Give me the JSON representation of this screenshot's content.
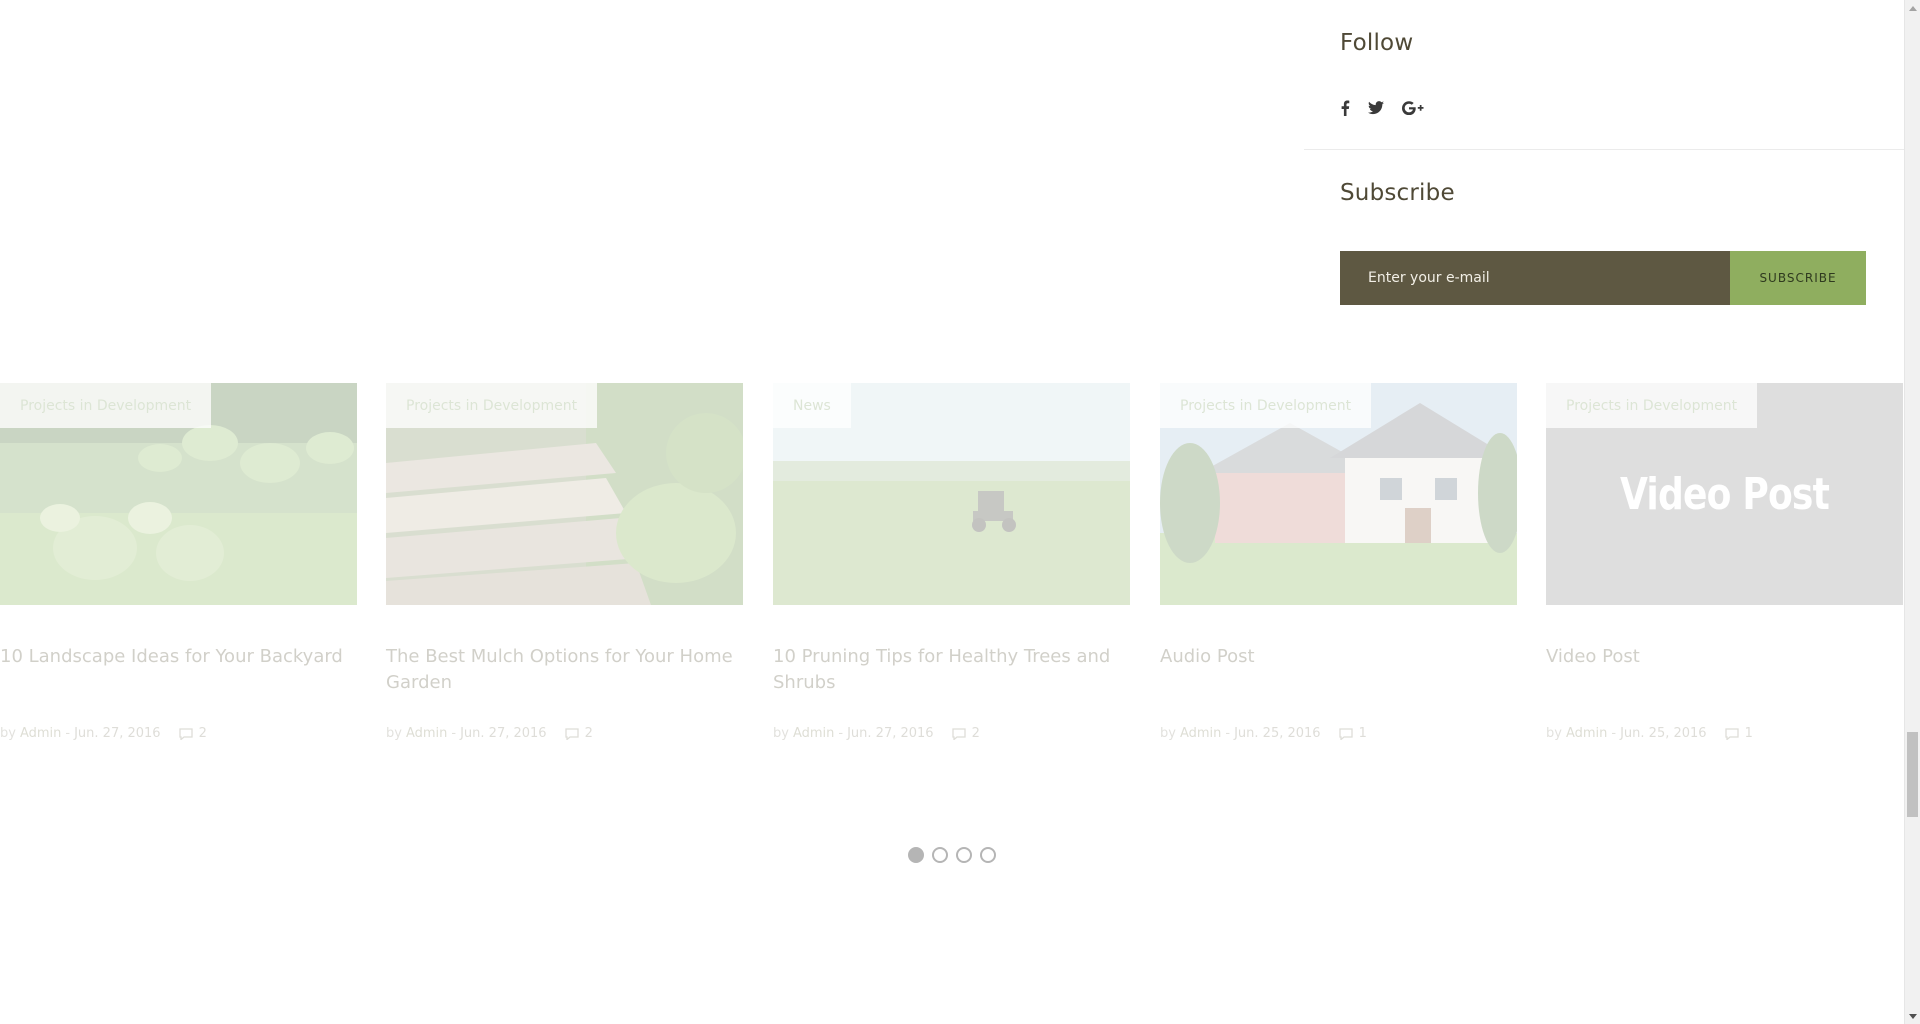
{
  "follow": {
    "title": "Follow",
    "social": [
      {
        "icon": "facebook-icon"
      },
      {
        "icon": "twitter-icon"
      },
      {
        "icon": "google-plus-icon"
      }
    ]
  },
  "subscribe": {
    "title": "Subscribe",
    "placeholder": "Enter your e-mail",
    "button_label": "SUBSCRIBE"
  },
  "posts": [
    {
      "category": "Projects in Development",
      "title": "10 Landscape Ideas for Your Backyard",
      "by": "by",
      "author": "Admin",
      "sep": "-",
      "date": "Jun. 27, 2016",
      "comments": "2"
    },
    {
      "category": "Projects in Development",
      "title": "The Best Mulch Options for Your Home Garden",
      "by": "by",
      "author": "Admin",
      "sep": "-",
      "date": "Jun. 27, 2016",
      "comments": "2"
    },
    {
      "category": "News",
      "title": "10 Pruning Tips for Healthy Trees and Shrubs",
      "by": "by",
      "author": "Admin",
      "sep": "-",
      "date": "Jun. 27, 2016",
      "comments": "2"
    },
    {
      "category": "Projects in Development",
      "title": "Audio Post",
      "by": "by",
      "author": "Admin",
      "sep": "-",
      "date": "Jun. 25, 2016",
      "comments": "1"
    },
    {
      "category": "Projects in Development",
      "title": "Video Post",
      "by": "by",
      "author": "Admin",
      "sep": "-",
      "date": "Jun. 25, 2016",
      "comments": "1",
      "image_text": "Video Post"
    }
  ],
  "pagination": {
    "pages": 4,
    "active": 1
  },
  "colors": {
    "input_bg": "#5e5842",
    "button_bg": "#8fae5f",
    "title_text": "#4f4936"
  }
}
